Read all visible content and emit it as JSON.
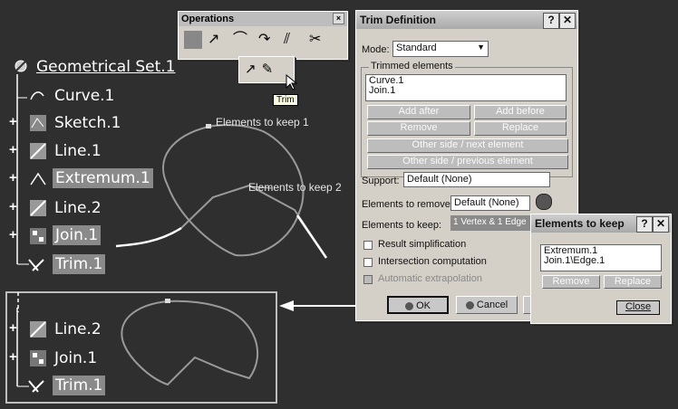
{
  "tree_top": {
    "items": [
      {
        "label": "Geometrical Set.1"
      },
      {
        "label": "Curve.1"
      },
      {
        "label": "Sketch.1"
      },
      {
        "label": "Line.1"
      },
      {
        "label": "Extremum.1"
      },
      {
        "label": "Line.2"
      },
      {
        "label": "Join.1"
      },
      {
        "label": "Trim.1"
      }
    ]
  },
  "tree_bottom": {
    "items": [
      {
        "label": "Line.2"
      },
      {
        "label": "Join.1"
      },
      {
        "label": "Trim.1"
      }
    ]
  },
  "annotations": {
    "keep1": "Elements to keep 1",
    "keep2": "Elements to keep 2"
  },
  "operations_toolbar": {
    "title": "Operations",
    "tooltip": "Trim",
    "icons": [
      "join-icon",
      "healing-icon",
      "curve-smooth-icon",
      "untrim-icon",
      "disassemble-icon",
      "split-icon",
      "trim-icon"
    ]
  },
  "trim_dialog": {
    "title": "Trim Definition",
    "mode_label": "Mode:",
    "mode_value": "Standard",
    "trimmed_group": "Trimmed elements",
    "trimmed_list": [
      "Curve.1",
      "Join.1"
    ],
    "add_after": "Add after",
    "add_before": "Add before",
    "remove": "Remove",
    "replace": "Replace",
    "other_side_next": "Other side / next element",
    "other_side_prev": "Other side / previous element",
    "support_label": "Support:",
    "support_value": "Default (None)",
    "remove_label": "Elements to remove:",
    "remove_value": "Default (None)",
    "keep_label": "Elements to keep:",
    "keep_value": "1 Vertex & 1 Edge",
    "result_simplification": "Result simplification",
    "intersection_computation": "Intersection computation",
    "automatic_extrapolation": "Automatic extrapolation",
    "ok": "OK",
    "cancel": "Cancel",
    "preview_partial": "P"
  },
  "keep_dialog": {
    "title": "Elements to keep",
    "list": [
      "Extremum.1",
      "Join.1\\Edge.1"
    ],
    "remove": "Remove",
    "replace": "Replace",
    "close": "Close"
  },
  "colors": {
    "background": "#2f2f2f",
    "highlight": "#8a8a8a",
    "dialog": "#d4d0c8"
  }
}
